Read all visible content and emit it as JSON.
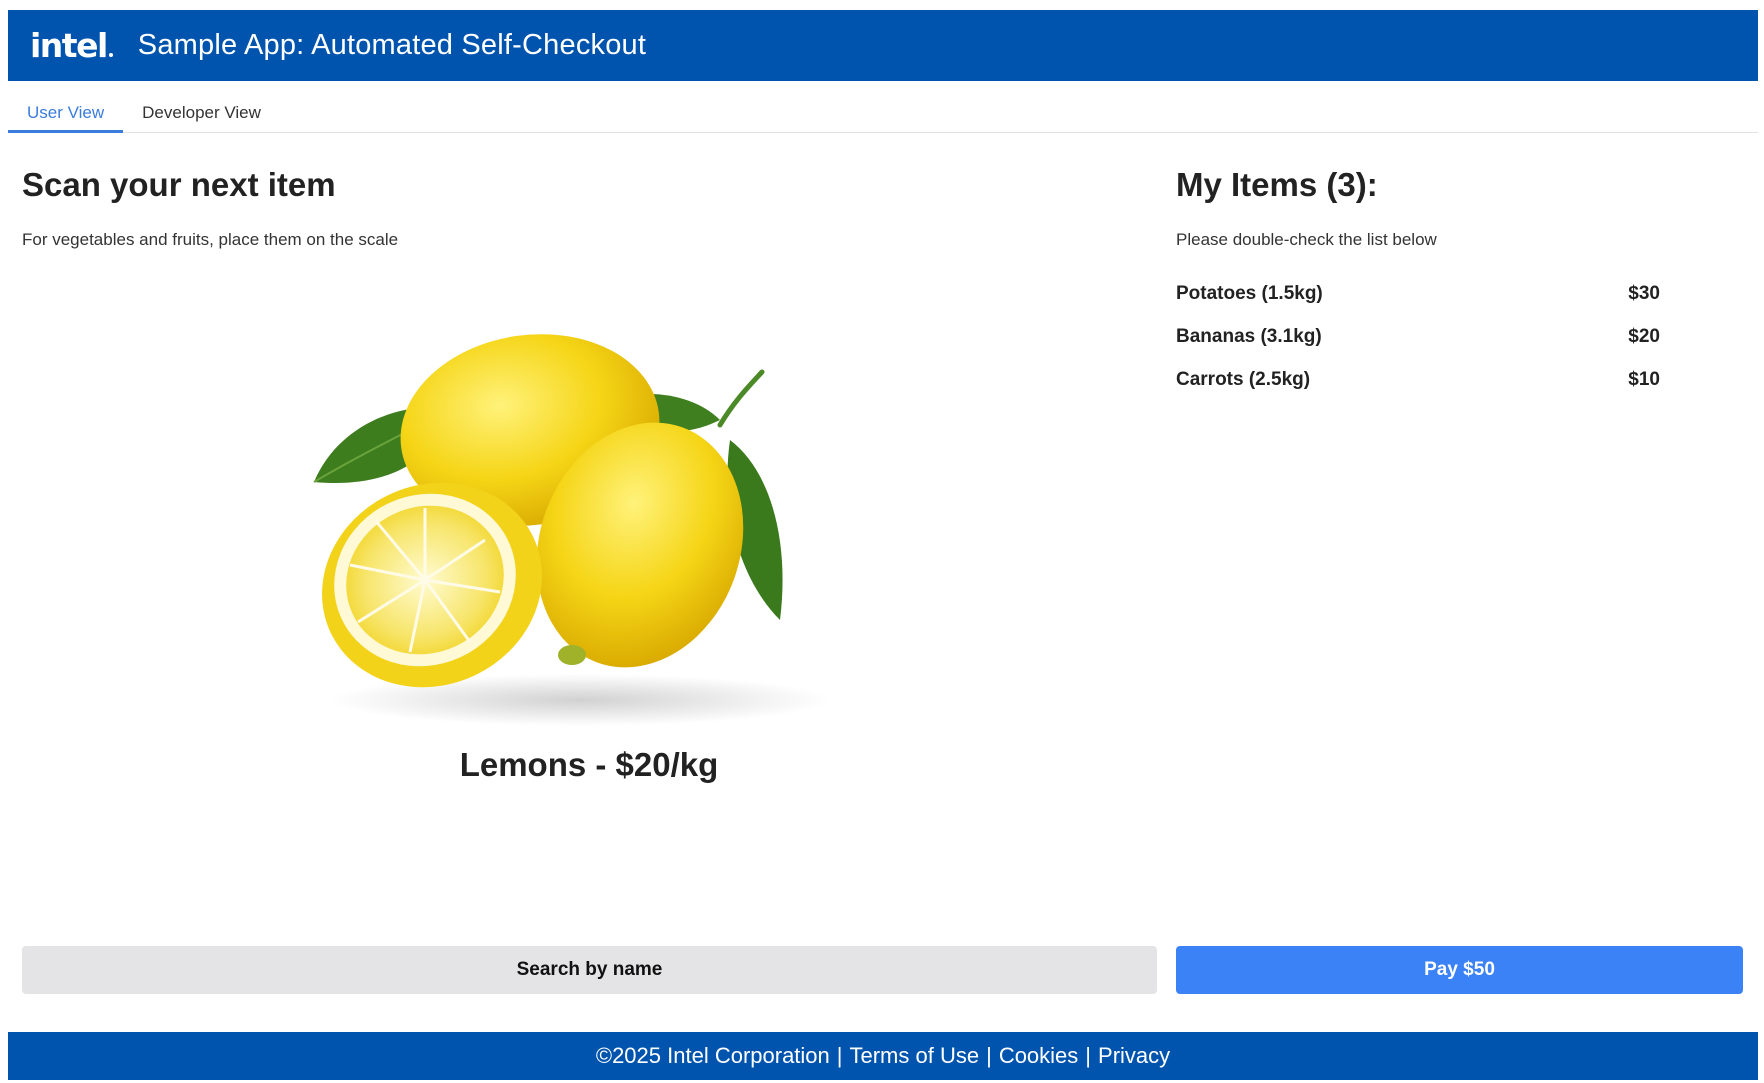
{
  "header": {
    "logo": "intel",
    "title": "Sample App: Automated Self-Checkout"
  },
  "tabs": [
    {
      "label": "User View",
      "active": true
    },
    {
      "label": "Developer View",
      "active": false
    }
  ],
  "scan": {
    "title": "Scan your next item",
    "subtitle": "For vegetables and fruits, place them on the scale",
    "product_label": "Lemons - $20/kg"
  },
  "cart": {
    "title": "My Items (3):",
    "subtitle": "Please double-check the list below",
    "items": [
      {
        "name": "Potatoes (1.5kg)",
        "price": "$30"
      },
      {
        "name": "Bananas (3.1kg)",
        "price": "$20"
      },
      {
        "name": "Carrots (2.5kg)",
        "price": "$10"
      }
    ]
  },
  "actions": {
    "search_label": "Search by name",
    "pay_label": "Pay $50"
  },
  "footer": {
    "copyright": "©2025 Intel Corporation",
    "separator": "|",
    "terms": "Terms of Use",
    "cookies": "Cookies",
    "privacy": "Privacy"
  },
  "colors": {
    "brand_blue": "#0054ae",
    "accent_blue": "#3b82f6",
    "tab_active": "#3b7ddd",
    "search_button_bg": "#e4e4e6"
  }
}
